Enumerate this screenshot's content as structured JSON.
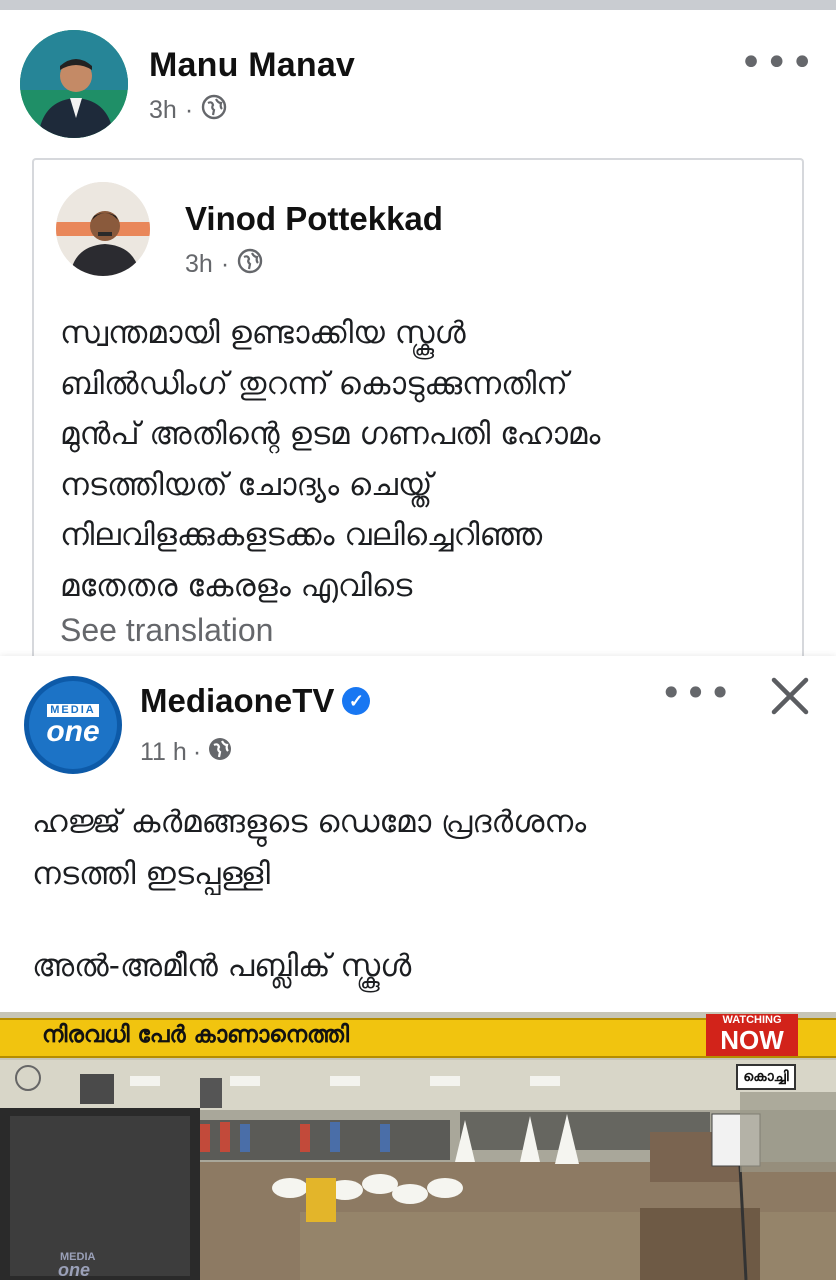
{
  "post": {
    "author": "Manu Manav",
    "time": "3h",
    "more_label": "•••"
  },
  "shared": {
    "author": "Vinod Pottekkad",
    "time": "3h",
    "lines": [
      "സ്വന്തമായി ഉണ്ടാക്കിയ സ്കൂൾ",
      "ബിൽഡിംഗ് തുറന്ന് കൊടുക്കുന്നതിന്",
      "മുൻപ് അതിന്റെ ഉടമ  ഗണപതി ഹോമം",
      "നടത്തിയത് ചോദ്യം ചെയ്ത്",
      "നിലവിളക്കുകളടക്കം വലിച്ചെറിഞ്ഞ",
      "മതേതര കേരളം എവിടെ"
    ],
    "see_translation": "See translation"
  },
  "mediaone": {
    "author": "MediaoneTV",
    "time": "11 h",
    "avatar_top": "MEDIA",
    "avatar_bottom": "one",
    "more_label": "•••",
    "text_line1": "ഹജ്ജ് കർമങ്ങളുടെ ഡെമോ പ്രദർശനം",
    "text_line2": "നടത്തി ഇടപ്പള്ളി",
    "text_line3": "അൽ-അമീൻ പബ്ലിക് സ്കൂൾ",
    "video": {
      "ticker": "നിരവധി പേർ കാണാനെത്തി",
      "watching_top": "WATCHING",
      "watching_bottom": "NOW",
      "location": "കൊച്ചി",
      "watermark_top": "MEDIA",
      "watermark_bottom": "one"
    }
  },
  "colors": {
    "meta": "#65676b",
    "verified": "#1877f2",
    "ticker": "#f1c40f",
    "live_red": "#d2231a"
  }
}
